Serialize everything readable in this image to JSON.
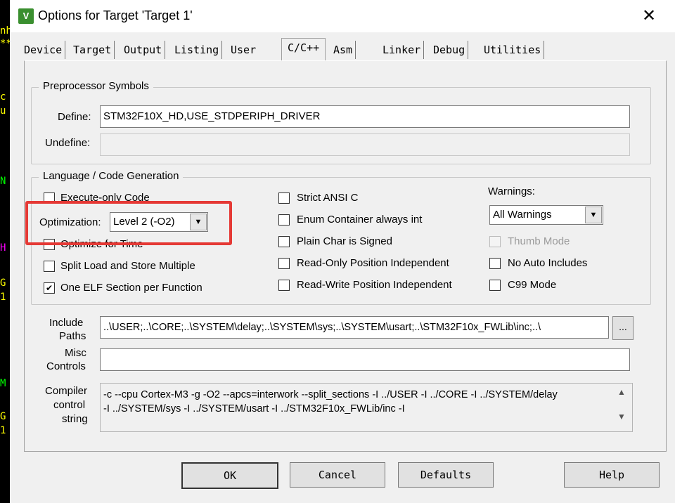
{
  "window": {
    "title": "Options for Target 'Target 1'",
    "app_icon": "V",
    "close_glyph": "✕"
  },
  "tabs": [
    "Device",
    "Target",
    "Output",
    "Listing",
    "User",
    "C/C++",
    "Asm",
    "Linker",
    "Debug",
    "Utilities"
  ],
  "preprocessor": {
    "group_title": "Preprocessor Symbols",
    "define_label": "Define:",
    "define_value": "STM32F10X_HD,USE_STDPERIPH_DRIVER",
    "undefine_label": "Undefine:",
    "undefine_value": ""
  },
  "codegen": {
    "group_title": "Language / Code Generation",
    "execute_only": {
      "label": "Execute-only Code",
      "checked": false
    },
    "optimization_label": "Optimization:",
    "optimization_value": "Level 2 (-O2)",
    "optimize_time": {
      "label": "Optimize for Time",
      "checked": false
    },
    "split_load": {
      "label": "Split Load and Store Multiple",
      "checked": false
    },
    "one_elf": {
      "label": "One ELF Section per Function",
      "checked": true
    },
    "strict_ansi": {
      "label": "Strict ANSI C",
      "checked": false
    },
    "enum_container": {
      "label": "Enum Container always int",
      "checked": false
    },
    "plain_char": {
      "label": "Plain Char is Signed",
      "checked": false
    },
    "readonly_pi": {
      "label": "Read-Only Position Independent",
      "checked": false
    },
    "readwrite_pi": {
      "label": "Read-Write Position Independent",
      "checked": false
    },
    "warnings_label": "Warnings:",
    "warnings_value": "All Warnings",
    "thumb_mode": {
      "label": "Thumb Mode",
      "checked": false,
      "enabled": false
    },
    "no_auto_includes": {
      "label": "No Auto Includes",
      "checked": false
    },
    "c99_mode": {
      "label": "C99 Mode",
      "checked": false
    }
  },
  "include": {
    "label_line1": "Include",
    "label_line2": "Paths",
    "value": "..\\USER;..\\CORE;..\\SYSTEM\\delay;..\\SYSTEM\\sys;..\\SYSTEM\\usart;..\\STM32F10x_FWLib\\inc;..\\",
    "browse_label": "..."
  },
  "misc": {
    "label_line1": "Misc",
    "label_line2": "Controls",
    "value": ""
  },
  "compiler": {
    "label_line1": "Compiler",
    "label_line2": "control",
    "label_line3": "string",
    "line1": "-c --cpu Cortex-M3 -g -O2 --apcs=interwork --split_sections -I ../USER -I ../CORE -I ../SYSTEM/delay",
    "line2": "-I ../SYSTEM/sys -I ../SYSTEM/usart -I ../STM32F10x_FWLib/inc -I"
  },
  "buttons": {
    "ok": "OK",
    "cancel": "Cancel",
    "defaults": "Defaults",
    "help": "Help"
  },
  "background_strip": [
    {
      "text": "nh",
      "color": "#ffff00"
    },
    {
      "text": "**",
      "color": "#ffff00"
    },
    {
      "text": "c",
      "color": "#ffff00"
    },
    {
      "text": "u",
      "color": "#ffff00"
    },
    {
      "text": "N",
      "color": "#00ff00"
    },
    {
      "text": "H",
      "color": "#ff00ff"
    },
    {
      "text": "G",
      "color": "#ffff00"
    },
    {
      "text": "1",
      "color": "#ffff00"
    },
    {
      "text": "M",
      "color": "#00ff00"
    },
    {
      "text": "G",
      "color": "#ffff00"
    },
    {
      "text": "1",
      "color": "#ffff00"
    }
  ],
  "colors": {
    "highlight": "#e53935",
    "dialog_bg": "#f0f0f0"
  }
}
